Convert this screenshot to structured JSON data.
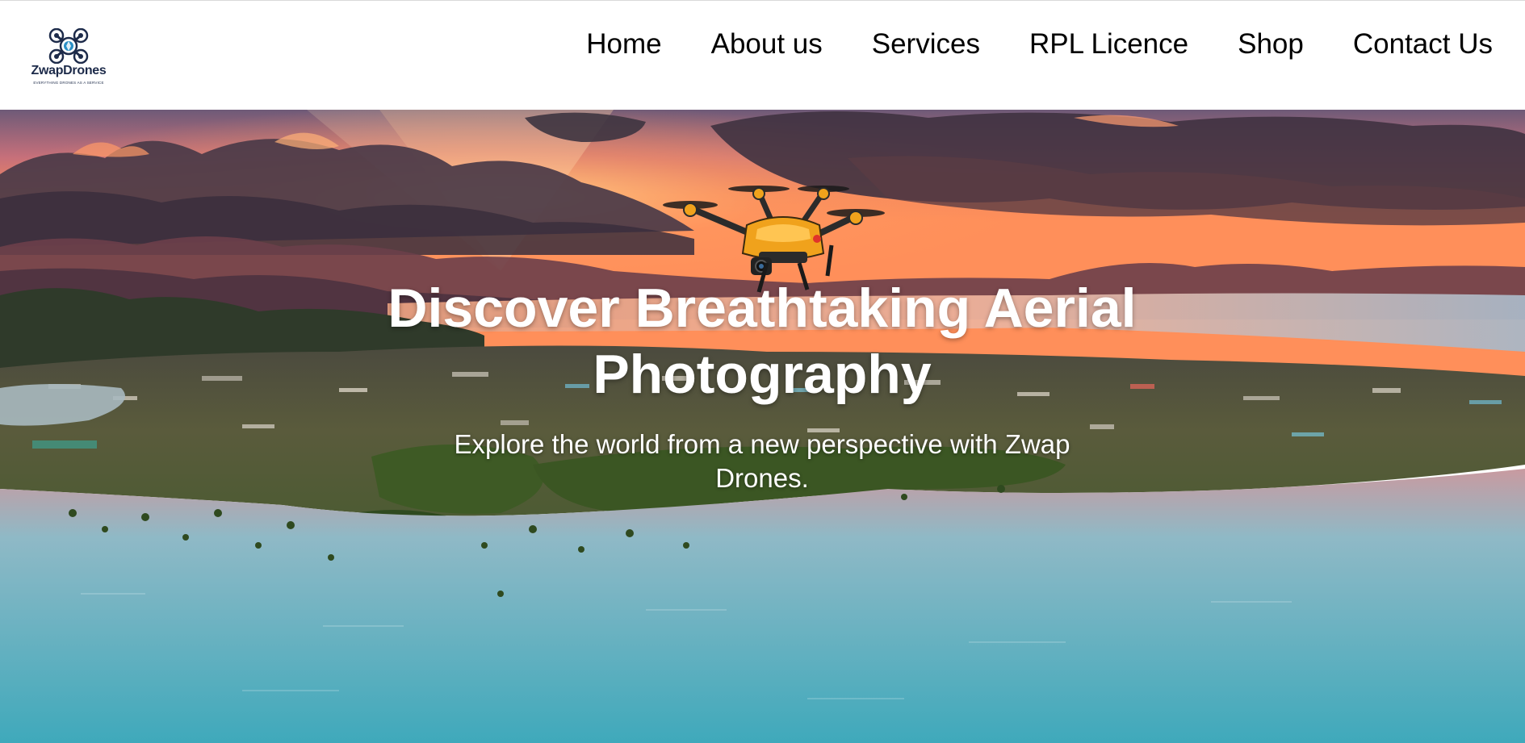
{
  "brand": {
    "name": "ZwapDrones",
    "tagline": "EVERYTHING DRONES AS A SERVICE"
  },
  "nav": {
    "items": [
      {
        "label": "Home"
      },
      {
        "label": "About us"
      },
      {
        "label": "Services"
      },
      {
        "label": "RPL Licence"
      },
      {
        "label": "Shop"
      },
      {
        "label": "Contact Us"
      }
    ]
  },
  "hero": {
    "title": "Discover Breathtaking Aerial Photography",
    "subtitle": "Explore the world from a new perspective with Zwap Drones."
  },
  "colors": {
    "brand_dark": "#1d2b4a",
    "brand_accent": "#2a8fc6",
    "drone_body": "#f0a21c",
    "sky_top": "#8a5a6e",
    "sky_glow": "#ff7a45",
    "sea": "#4fb3c4"
  },
  "icons": {
    "logo": "drone-logo-icon",
    "hero_drone": "quadcopter-drone-icon"
  }
}
